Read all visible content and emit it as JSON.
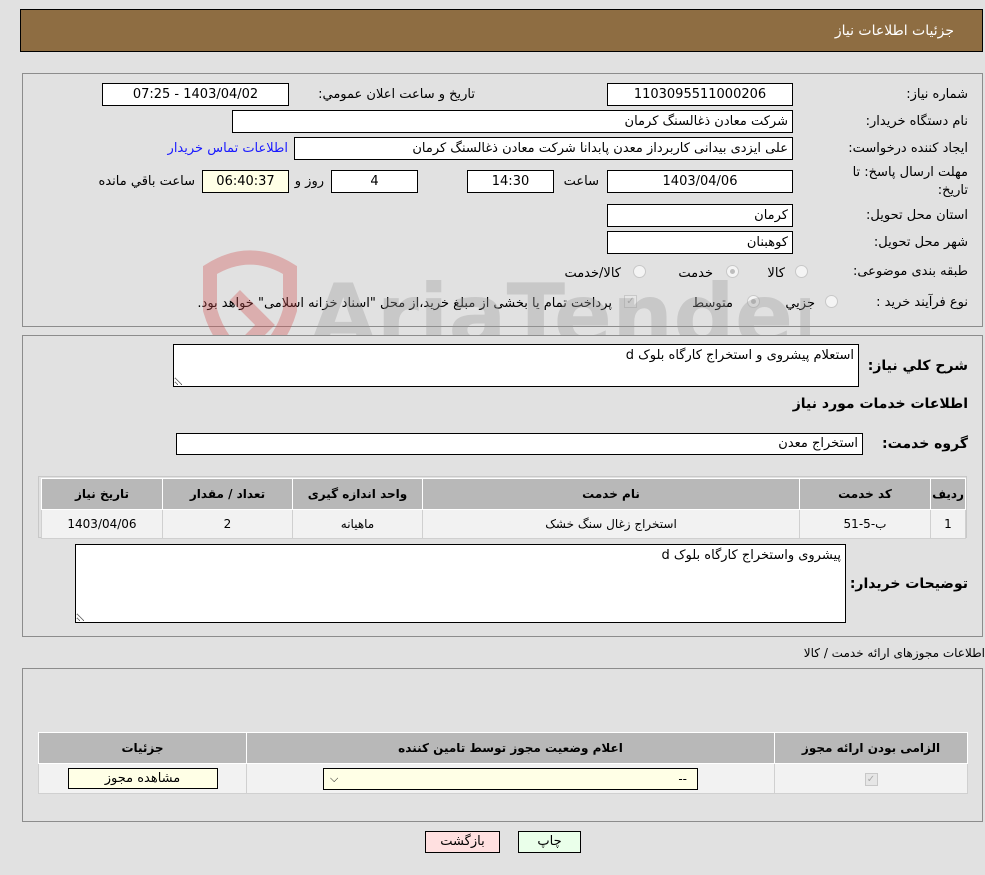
{
  "header": {
    "title": "جزئیات اطلاعات نیاز"
  },
  "details": {
    "need_number_label": "شماره نیاز:",
    "need_number": "1103095511000206",
    "announce_label": "تاریخ و ساعت اعلان عمومي:",
    "announce_value": "1403/04/02 - 07:25",
    "buyer_org_label": "نام دستگاه خریدار:",
    "buyer_org": "شرکت معادن ذغالسنگ کرمان",
    "creator_label": "ایجاد کننده درخواست:",
    "creator": "علی ایزدی بیدانی کاربرداز معدن پابدانا شرکت معادن ذغالسنگ کرمان",
    "contact_link": "اطلاعات تماس خریدار",
    "deadline_label_1": "مهلت ارسال پاسخ: تا",
    "deadline_label_2": "تاریخ:",
    "deadline_date": "1403/04/06",
    "time_label": "ساعت",
    "deadline_time": "14:30",
    "days_value": "4",
    "days_label": "روز و",
    "remaining_time": "06:40:37",
    "remaining_label": "ساعت باقي مانده",
    "province_label": "استان محل تحویل:",
    "province": "کرمان",
    "city_label": "شهر محل تحویل:",
    "city": "کوهبنان",
    "category_label": "طبقه بندی موضوعی:",
    "category_options": [
      "کالا",
      "خدمت",
      "کالا/خدمت"
    ],
    "category_selected": "خدمت",
    "process_label": "نوع فرآیند خرید :",
    "process_options": [
      "جزيي",
      "متوسط"
    ],
    "process_selected": "متوسط",
    "treasury_note": "پرداخت تمام یا بخشی از مبلغ خرید،از محل \"اسناد خزانه اسلامی\" خواهد بود."
  },
  "description": {
    "label": "شرح کلي نیاز:",
    "value": "استعلام پیشروی و استخراج کارگاه بلوک d",
    "services_heading": "اطلاعات خدمات مورد نیاز",
    "service_group_label": "گروه خدمت:",
    "service_group": "استخراج معدن"
  },
  "services_table": {
    "headers": [
      "ردیف",
      "کد خدمت",
      "نام خدمت",
      "واحد اندازه گیری",
      "تعداد / مقدار",
      "تاریخ نیاز"
    ],
    "rows": [
      [
        "1",
        "ب-5-51",
        "استخراج زغال سنگ خشک",
        "ماهیانه",
        "2",
        "1403/04/06"
      ]
    ]
  },
  "buyer_notes": {
    "label": "توضیحات خریدار:",
    "value": "پیشروی واستخراج کارگاه بلوک d"
  },
  "permits": {
    "heading": "اطلاعات مجوزهای ارائه خدمت / کالا",
    "headers": [
      "الزامی بودن ارائه مجوز",
      "اعلام وضعیت مجوز توسط تامین کننده",
      "جزئیات"
    ],
    "select_value": "--",
    "view_button": "مشاهده مجوز"
  },
  "footer": {
    "print_button": "چاپ",
    "back_button": "بازگشت"
  },
  "watermark": {
    "text": "AriaTender.neT"
  },
  "colors": {
    "header_bg": "#8e6d42",
    "link": "#1a1aff",
    "back_btn": "#ffe0e0",
    "print_btn": "#eaffea"
  }
}
